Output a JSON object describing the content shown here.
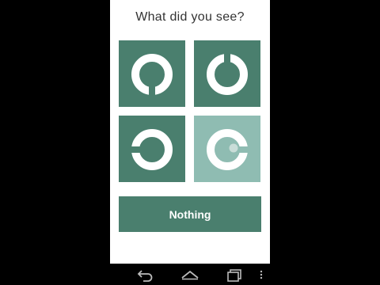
{
  "question": "What did you see?",
  "options": [
    {
      "icon": "ring-gap-bottom-icon",
      "selected": false
    },
    {
      "icon": "ring-gap-top-icon",
      "selected": false
    },
    {
      "icon": "ring-gap-left-icon",
      "selected": false
    },
    {
      "icon": "ring-gap-right-dot-icon",
      "selected": true
    }
  ],
  "nothing_label": "Nothing",
  "colors": {
    "tile": "#4a7f6e",
    "tile_selected": "#8fbcb2",
    "button": "#4a7f6e",
    "ring": "#ffffff"
  },
  "navbar": {
    "icons": [
      "back-icon",
      "home-icon",
      "recents-icon",
      "menu-icon"
    ]
  }
}
